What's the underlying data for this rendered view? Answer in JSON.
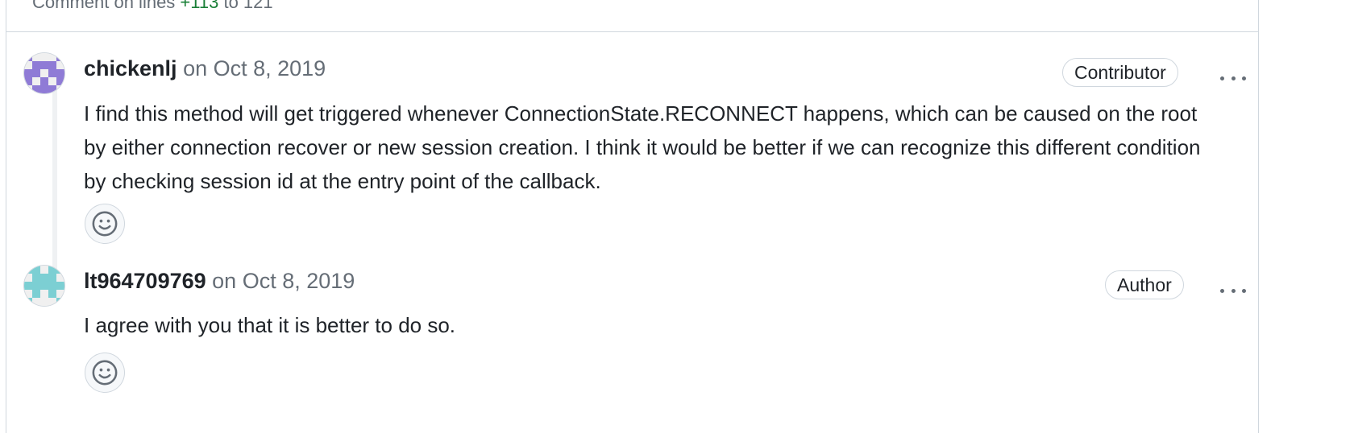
{
  "thread": {
    "header": {
      "prefix": "Comment on lines ",
      "start_line": "+113",
      "middle": " to ",
      "end_line": "121"
    },
    "comments": [
      {
        "author": "chickenlj",
        "timestamp": "on Oct 8, 2019",
        "role": "Contributor",
        "body": "I find this method will get triggered whenever ConnectionState.RECONNECT happens, which can be caused on the root by either connection recover or new session creation. I think it would be better if we can recognize this different condition by checking session id at the entry point of the callback.",
        "avatar_color": "#8f7bd6"
      },
      {
        "author": "lt964709769",
        "timestamp": "on Oct 8, 2019",
        "role": "Author",
        "body": "I agree with you that it is better to do so.",
        "avatar_color": "#7ccfd3"
      }
    ]
  },
  "icons": {
    "reaction": "smiley-icon",
    "menu": "kebab-horizontal-icon"
  },
  "colors": {
    "added_line": "#1a7f37",
    "muted_text": "#656d76",
    "border": "#d0d7de"
  }
}
